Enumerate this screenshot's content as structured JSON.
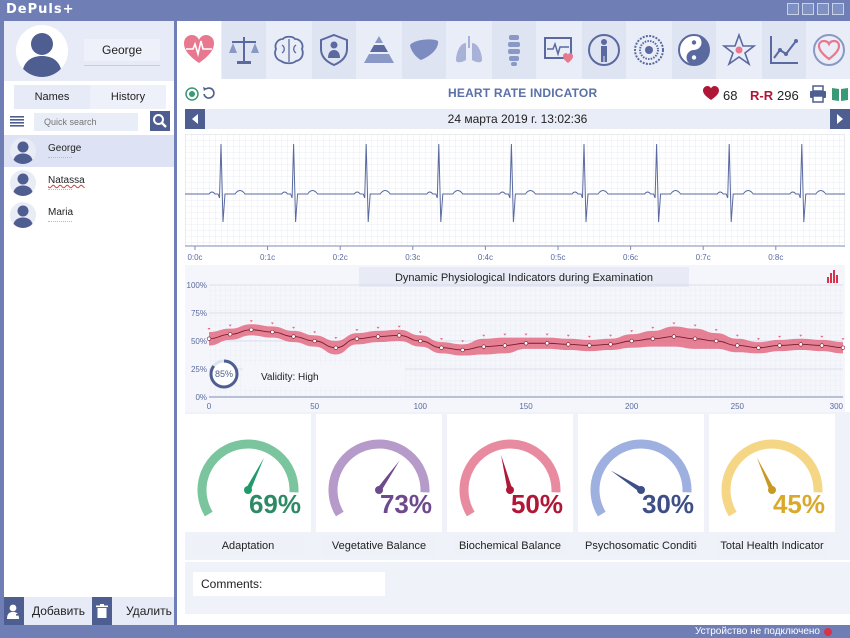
{
  "app": {
    "title": "DePuls+"
  },
  "profile": {
    "name": "George"
  },
  "tabs": {
    "names": "Names",
    "history": "History"
  },
  "search": {
    "placeholder": "Quick search"
  },
  "users": [
    {
      "name": "George",
      "selected": true
    },
    {
      "name": "Natassa",
      "selected": false
    },
    {
      "name": "Maria",
      "selected": false
    }
  ],
  "left_actions": {
    "add": "Добавить",
    "delete": "Удалить"
  },
  "header": {
    "title": "HEART RATE INDICATOR",
    "hr": "68",
    "rr_label": "R-R",
    "rr": "296"
  },
  "date": "24 марта 2019 г. 13:02:36",
  "colors": {
    "accent": "#4f5e91",
    "brand": "#6f7fb6",
    "heart": "#b01737",
    "band": "#e0607a"
  },
  "ecg": {
    "ticks": [
      "0:0c",
      "0:1c",
      "0:2c",
      "0:3c",
      "0:4c",
      "0:5c",
      "0:6c",
      "0:7c",
      "0:8c"
    ]
  },
  "chart_data": {
    "type": "line",
    "title": "Dynamic Physiological Indicators during Examination",
    "xlim": [
      0,
      300
    ],
    "ylim": [
      0,
      100
    ],
    "xticks": [
      "0",
      "50",
      "100",
      "150",
      "200",
      "250",
      "300"
    ],
    "yticks": [
      "0%",
      "25%",
      "50%",
      "75%",
      "100%"
    ],
    "series": [
      {
        "x": [
          0,
          10,
          20,
          30,
          40,
          50,
          60,
          70,
          80,
          90,
          100,
          110,
          120,
          130,
          140,
          150,
          160,
          170,
          180,
          190,
          200,
          210,
          220,
          230,
          240,
          250,
          260,
          270,
          280,
          290,
          300
        ],
        "y": [
          52,
          56,
          60,
          58,
          54,
          50,
          44,
          52,
          54,
          55,
          50,
          44,
          42,
          45,
          46,
          48,
          48,
          47,
          46,
          47,
          50,
          52,
          54,
          52,
          50,
          46,
          44,
          46,
          47,
          46,
          44
        ],
        "band": [
          6,
          5,
          5,
          5,
          5,
          5,
          6,
          5,
          5,
          5,
          5,
          5,
          5,
          7,
          7,
          5,
          5,
          5,
          5,
          5,
          6,
          7,
          9,
          9,
          7,
          6,
          5,
          5,
          5,
          5,
          5
        ]
      }
    ],
    "validity_percent": "85%",
    "validity_label": "Validity: High",
    "grid": true
  },
  "gauges": [
    {
      "label": "Adaptation",
      "value": 69,
      "display": "69%",
      "color": "#7bc59e",
      "needle": "#1f9a6a",
      "text_color": "#2e8a64"
    },
    {
      "label": "Vegetative Balance",
      "value": 73,
      "display": "73%",
      "color": "#b69ac9",
      "needle": "#6e4a8c",
      "text_color": "#6e4a8c"
    },
    {
      "label": "Biochemical Balance",
      "value": 50,
      "display": "50%",
      "color": "#e88aa0",
      "needle": "#b01737",
      "text_color": "#b01737"
    },
    {
      "label": "Psychosomatic Condition",
      "value": 30,
      "display": "30%",
      "color": "#9eb0e0",
      "needle": "#3d4f86",
      "text_color": "#3d4f86"
    },
    {
      "label": "Total Health Indicator",
      "value": 45,
      "display": "45%",
      "color": "#f5d685",
      "needle": "#c99a23",
      "text_color": "#d9a92c"
    }
  ],
  "comments": {
    "label": "Comments:"
  },
  "status": {
    "text": "Устройство не подключено"
  },
  "icons": [
    "heart-icon",
    "scales-icon",
    "brain-icon",
    "shield-icon",
    "pyramid-icon",
    "liver-icon",
    "lungs-icon",
    "spine-icon",
    "monitor-heart-icon",
    "person-icon",
    "mandala-icon",
    "yin-yang-icon",
    "star-icon",
    "trend-icon",
    "heart-hands-icon"
  ]
}
